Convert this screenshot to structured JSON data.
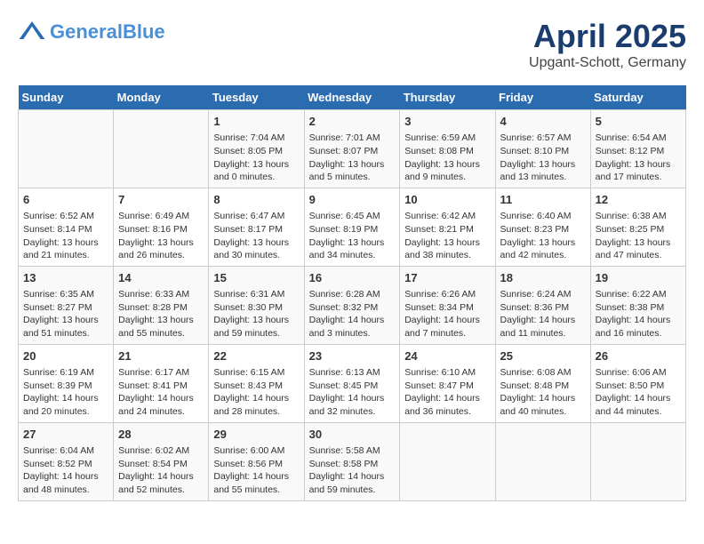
{
  "header": {
    "logo_line1": "General",
    "logo_line2": "Blue",
    "title": "April 2025",
    "subtitle": "Upgant-Schott, Germany"
  },
  "days_of_week": [
    "Sunday",
    "Monday",
    "Tuesday",
    "Wednesday",
    "Thursday",
    "Friday",
    "Saturday"
  ],
  "weeks": [
    [
      {
        "day": "",
        "empty": true
      },
      {
        "day": "",
        "empty": true
      },
      {
        "day": "1",
        "sunrise": "Sunrise: 7:04 AM",
        "sunset": "Sunset: 8:05 PM",
        "daylight": "Daylight: 13 hours and 0 minutes."
      },
      {
        "day": "2",
        "sunrise": "Sunrise: 7:01 AM",
        "sunset": "Sunset: 8:07 PM",
        "daylight": "Daylight: 13 hours and 5 minutes."
      },
      {
        "day": "3",
        "sunrise": "Sunrise: 6:59 AM",
        "sunset": "Sunset: 8:08 PM",
        "daylight": "Daylight: 13 hours and 9 minutes."
      },
      {
        "day": "4",
        "sunrise": "Sunrise: 6:57 AM",
        "sunset": "Sunset: 8:10 PM",
        "daylight": "Daylight: 13 hours and 13 minutes."
      },
      {
        "day": "5",
        "sunrise": "Sunrise: 6:54 AM",
        "sunset": "Sunset: 8:12 PM",
        "daylight": "Daylight: 13 hours and 17 minutes."
      }
    ],
    [
      {
        "day": "6",
        "sunrise": "Sunrise: 6:52 AM",
        "sunset": "Sunset: 8:14 PM",
        "daylight": "Daylight: 13 hours and 21 minutes."
      },
      {
        "day": "7",
        "sunrise": "Sunrise: 6:49 AM",
        "sunset": "Sunset: 8:16 PM",
        "daylight": "Daylight: 13 hours and 26 minutes."
      },
      {
        "day": "8",
        "sunrise": "Sunrise: 6:47 AM",
        "sunset": "Sunset: 8:17 PM",
        "daylight": "Daylight: 13 hours and 30 minutes."
      },
      {
        "day": "9",
        "sunrise": "Sunrise: 6:45 AM",
        "sunset": "Sunset: 8:19 PM",
        "daylight": "Daylight: 13 hours and 34 minutes."
      },
      {
        "day": "10",
        "sunrise": "Sunrise: 6:42 AM",
        "sunset": "Sunset: 8:21 PM",
        "daylight": "Daylight: 13 hours and 38 minutes."
      },
      {
        "day": "11",
        "sunrise": "Sunrise: 6:40 AM",
        "sunset": "Sunset: 8:23 PM",
        "daylight": "Daylight: 13 hours and 42 minutes."
      },
      {
        "day": "12",
        "sunrise": "Sunrise: 6:38 AM",
        "sunset": "Sunset: 8:25 PM",
        "daylight": "Daylight: 13 hours and 47 minutes."
      }
    ],
    [
      {
        "day": "13",
        "sunrise": "Sunrise: 6:35 AM",
        "sunset": "Sunset: 8:27 PM",
        "daylight": "Daylight: 13 hours and 51 minutes."
      },
      {
        "day": "14",
        "sunrise": "Sunrise: 6:33 AM",
        "sunset": "Sunset: 8:28 PM",
        "daylight": "Daylight: 13 hours and 55 minutes."
      },
      {
        "day": "15",
        "sunrise": "Sunrise: 6:31 AM",
        "sunset": "Sunset: 8:30 PM",
        "daylight": "Daylight: 13 hours and 59 minutes."
      },
      {
        "day": "16",
        "sunrise": "Sunrise: 6:28 AM",
        "sunset": "Sunset: 8:32 PM",
        "daylight": "Daylight: 14 hours and 3 minutes."
      },
      {
        "day": "17",
        "sunrise": "Sunrise: 6:26 AM",
        "sunset": "Sunset: 8:34 PM",
        "daylight": "Daylight: 14 hours and 7 minutes."
      },
      {
        "day": "18",
        "sunrise": "Sunrise: 6:24 AM",
        "sunset": "Sunset: 8:36 PM",
        "daylight": "Daylight: 14 hours and 11 minutes."
      },
      {
        "day": "19",
        "sunrise": "Sunrise: 6:22 AM",
        "sunset": "Sunset: 8:38 PM",
        "daylight": "Daylight: 14 hours and 16 minutes."
      }
    ],
    [
      {
        "day": "20",
        "sunrise": "Sunrise: 6:19 AM",
        "sunset": "Sunset: 8:39 PM",
        "daylight": "Daylight: 14 hours and 20 minutes."
      },
      {
        "day": "21",
        "sunrise": "Sunrise: 6:17 AM",
        "sunset": "Sunset: 8:41 PM",
        "daylight": "Daylight: 14 hours and 24 minutes."
      },
      {
        "day": "22",
        "sunrise": "Sunrise: 6:15 AM",
        "sunset": "Sunset: 8:43 PM",
        "daylight": "Daylight: 14 hours and 28 minutes."
      },
      {
        "day": "23",
        "sunrise": "Sunrise: 6:13 AM",
        "sunset": "Sunset: 8:45 PM",
        "daylight": "Daylight: 14 hours and 32 minutes."
      },
      {
        "day": "24",
        "sunrise": "Sunrise: 6:10 AM",
        "sunset": "Sunset: 8:47 PM",
        "daylight": "Daylight: 14 hours and 36 minutes."
      },
      {
        "day": "25",
        "sunrise": "Sunrise: 6:08 AM",
        "sunset": "Sunset: 8:48 PM",
        "daylight": "Daylight: 14 hours and 40 minutes."
      },
      {
        "day": "26",
        "sunrise": "Sunrise: 6:06 AM",
        "sunset": "Sunset: 8:50 PM",
        "daylight": "Daylight: 14 hours and 44 minutes."
      }
    ],
    [
      {
        "day": "27",
        "sunrise": "Sunrise: 6:04 AM",
        "sunset": "Sunset: 8:52 PM",
        "daylight": "Daylight: 14 hours and 48 minutes."
      },
      {
        "day": "28",
        "sunrise": "Sunrise: 6:02 AM",
        "sunset": "Sunset: 8:54 PM",
        "daylight": "Daylight: 14 hours and 52 minutes."
      },
      {
        "day": "29",
        "sunrise": "Sunrise: 6:00 AM",
        "sunset": "Sunset: 8:56 PM",
        "daylight": "Daylight: 14 hours and 55 minutes."
      },
      {
        "day": "30",
        "sunrise": "Sunrise: 5:58 AM",
        "sunset": "Sunset: 8:58 PM",
        "daylight": "Daylight: 14 hours and 59 minutes."
      },
      {
        "day": "",
        "empty": true
      },
      {
        "day": "",
        "empty": true
      },
      {
        "day": "",
        "empty": true
      }
    ]
  ]
}
